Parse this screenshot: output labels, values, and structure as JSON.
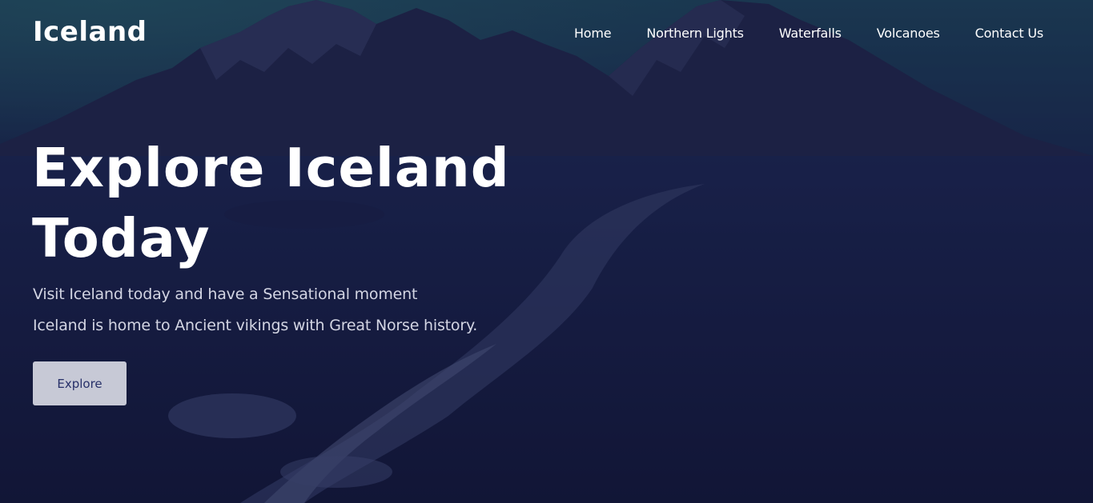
{
  "brand": {
    "logo_text": "Iceland"
  },
  "nav": {
    "items": [
      {
        "label": "Home"
      },
      {
        "label": "Northern Lights"
      },
      {
        "label": "Waterfalls"
      },
      {
        "label": "Volcanoes"
      },
      {
        "label": "Contact Us"
      }
    ]
  },
  "hero": {
    "headline_line1": "Explore Iceland",
    "headline_line2": "Today",
    "subtext_line1": "Visit Iceland today and have a Sensational moment",
    "subtext_line2": "Iceland is home to Ancient vikings with Great Norse history.",
    "button_label": "Explore"
  },
  "colors": {
    "overlay": "#141a3a",
    "text": "#ffffff",
    "subtext": "#d3d5e3",
    "button_bg": "#c7c9d6",
    "button_text": "#273069"
  }
}
